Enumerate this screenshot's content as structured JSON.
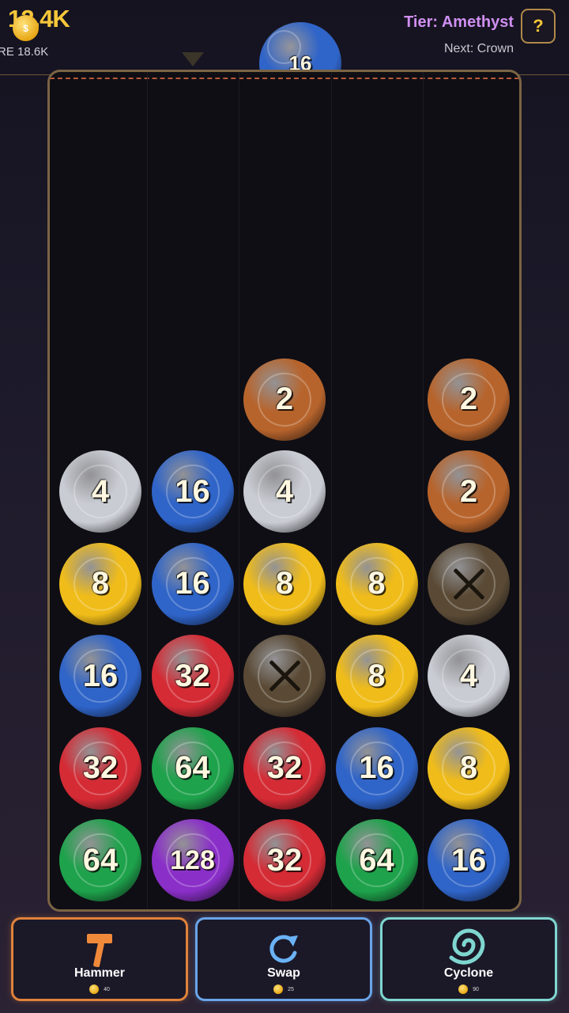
{
  "header": {
    "score": "12.4K",
    "coin_badge": "$",
    "best": "RE 18.6K",
    "tier": "Tier: Amethyst",
    "next": "Next: Crown",
    "help_label": "?"
  },
  "next_ball": {
    "value": "16",
    "color": "blue"
  },
  "palette": {
    "bronze": "#b7642c",
    "silver": "#c9ccd3",
    "gold": "#f0bc1a",
    "blue": "#2f64c8",
    "red": "#d42b35",
    "green": "#1ea24b",
    "purple": "#8a2fc8",
    "blocker": "#5a4a35"
  },
  "board": {
    "cols": 5,
    "rows": 9,
    "balls": [
      {
        "col": 2,
        "row": 3,
        "value": "2",
        "color": "bronze"
      },
      {
        "col": 4,
        "row": 3,
        "value": "2",
        "color": "bronze"
      },
      {
        "col": 0,
        "row": 4,
        "value": "4",
        "color": "silver"
      },
      {
        "col": 1,
        "row": 4,
        "value": "16",
        "color": "blue"
      },
      {
        "col": 2,
        "row": 4,
        "value": "4",
        "color": "silver"
      },
      {
        "col": 4,
        "row": 4,
        "value": "2",
        "color": "bronze"
      },
      {
        "col": 0,
        "row": 5,
        "value": "8",
        "color": "gold"
      },
      {
        "col": 1,
        "row": 5,
        "value": "16",
        "color": "blue"
      },
      {
        "col": 2,
        "row": 5,
        "value": "8",
        "color": "gold"
      },
      {
        "col": 3,
        "row": 5,
        "value": "8",
        "color": "gold"
      },
      {
        "col": 4,
        "row": 5,
        "value": "X",
        "color": "blocker"
      },
      {
        "col": 0,
        "row": 6,
        "value": "16",
        "color": "blue"
      },
      {
        "col": 1,
        "row": 6,
        "value": "32",
        "color": "red"
      },
      {
        "col": 2,
        "row": 6,
        "value": "X",
        "color": "blocker"
      },
      {
        "col": 3,
        "row": 6,
        "value": "8",
        "color": "gold"
      },
      {
        "col": 4,
        "row": 6,
        "value": "4",
        "color": "silver"
      },
      {
        "col": 0,
        "row": 7,
        "value": "32",
        "color": "red"
      },
      {
        "col": 1,
        "row": 7,
        "value": "64",
        "color": "green"
      },
      {
        "col": 2,
        "row": 7,
        "value": "32",
        "color": "red"
      },
      {
        "col": 3,
        "row": 7,
        "value": "16",
        "color": "blue"
      },
      {
        "col": 4,
        "row": 7,
        "value": "8",
        "color": "gold"
      },
      {
        "col": 0,
        "row": 8,
        "value": "64",
        "color": "green"
      },
      {
        "col": 1,
        "row": 8,
        "value": "128",
        "color": "purple"
      },
      {
        "col": 2,
        "row": 8,
        "value": "32",
        "color": "red"
      },
      {
        "col": 3,
        "row": 8,
        "value": "64",
        "color": "green"
      },
      {
        "col": 4,
        "row": 8,
        "value": "16",
        "color": "blue"
      }
    ]
  },
  "powerups": [
    {
      "label": "Hammer",
      "cost": "40",
      "icon": "hammer-icon",
      "border": "#e0823a"
    },
    {
      "label": "Swap",
      "cost": "25",
      "icon": "swap-icon",
      "border": "#6aa4e8"
    },
    {
      "label": "Cyclone",
      "cost": "90",
      "icon": "cyclone-icon",
      "border": "#7fd6d0"
    }
  ]
}
